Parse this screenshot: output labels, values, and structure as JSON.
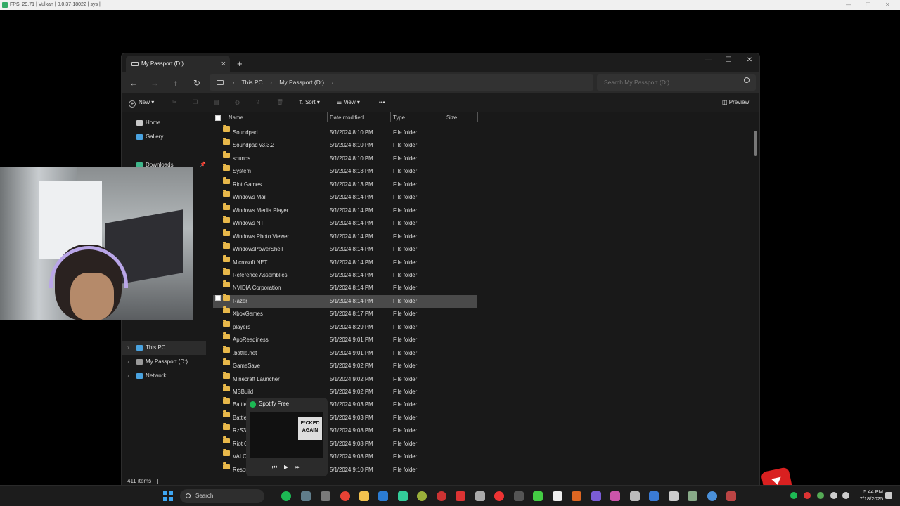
{
  "overlay": {
    "text": "FPS: 29.71 | Vulkan | 0.0.37-18022 | sys ||"
  },
  "window": {
    "tab_title": "My Passport (D:)",
    "new_tab": "+",
    "minimize": "—",
    "maximize": "☐",
    "close": "✕"
  },
  "address": {
    "back": "←",
    "forward": "→",
    "up": "↑",
    "refresh": "↻",
    "crumbs": [
      "This PC",
      "My Passport (D:)"
    ],
    "separator": "›",
    "search_placeholder": "Search My Passport (D:)"
  },
  "toolbar": {
    "new_label": "New",
    "sort_label": "Sort",
    "view_label": "View",
    "more_label": "•••",
    "preview_label": "Preview"
  },
  "nav": {
    "home": "Home",
    "gallery": "Gallery",
    "downloads": "Downloads",
    "this_pc": "This PC",
    "passport": "My Passport (D:)",
    "network": "Network"
  },
  "columns": {
    "name": "Name",
    "date": "Date modified",
    "type": "Type",
    "size": "Size"
  },
  "files": [
    {
      "name": "Soundpad",
      "date": "5/1/2024 8:10 PM",
      "type": "File folder"
    },
    {
      "name": "Soundpad v3.3.2",
      "date": "5/1/2024 8:10 PM",
      "type": "File folder"
    },
    {
      "name": "sounds",
      "date": "5/1/2024 8:10 PM",
      "type": "File folder"
    },
    {
      "name": "System",
      "date": "5/1/2024 8:13 PM",
      "type": "File folder"
    },
    {
      "name": "Riot Games",
      "date": "5/1/2024 8:13 PM",
      "type": "File folder"
    },
    {
      "name": "Windows Mail",
      "date": "5/1/2024 8:14 PM",
      "type": "File folder"
    },
    {
      "name": "Windows Media Player",
      "date": "5/1/2024 8:14 PM",
      "type": "File folder"
    },
    {
      "name": "Windows NT",
      "date": "5/1/2024 8:14 PM",
      "type": "File folder"
    },
    {
      "name": "Windows Photo Viewer",
      "date": "5/1/2024 8:14 PM",
      "type": "File folder"
    },
    {
      "name": "WindowsPowerShell",
      "date": "5/1/2024 8:14 PM",
      "type": "File folder"
    },
    {
      "name": "Microsoft.NET",
      "date": "5/1/2024 8:14 PM",
      "type": "File folder"
    },
    {
      "name": "Reference Assemblies",
      "date": "5/1/2024 8:14 PM",
      "type": "File folder"
    },
    {
      "name": "NVIDIA Corporation",
      "date": "5/1/2024 8:14 PM",
      "type": "File folder"
    },
    {
      "name": "Razer",
      "date": "5/1/2024 8:14 PM",
      "type": "File folder",
      "selected": true
    },
    {
      "name": "XboxGames",
      "date": "5/1/2024 8:17 PM",
      "type": "File folder"
    },
    {
      "name": "players",
      "date": "5/1/2024 8:29 PM",
      "type": "File folder"
    },
    {
      "name": "AppReadiness",
      "date": "5/1/2024 9:01 PM",
      "type": "File folder"
    },
    {
      "name": ".battle.net",
      "date": "5/1/2024 9:01 PM",
      "type": "File folder"
    },
    {
      "name": "GameSave",
      "date": "5/1/2024 9:02 PM",
      "type": "File folder"
    },
    {
      "name": "Minecraft Launcher",
      "date": "5/1/2024 9:02 PM",
      "type": "File folder"
    },
    {
      "name": "MSBuild",
      "date": "5/1/2024 9:02 PM",
      "type": "File folder"
    },
    {
      "name": "Battle.",
      "date": "5/1/2024 9:03 PM",
      "type": "File folder"
    },
    {
      "name": "Battle.",
      "date": "5/1/2024 9:03 PM",
      "type": "File folder"
    },
    {
      "name": "RzS3V",
      "date": "5/1/2024 9:08 PM",
      "type": "File folder"
    },
    {
      "name": "Riot C",
      "date": "5/1/2024 9:08 PM",
      "type": "File folder"
    },
    {
      "name": "VALOF",
      "date": "5/1/2024 9:08 PM",
      "type": "File folder"
    },
    {
      "name": "Resou",
      "date": "5/1/2024 9:10 PM",
      "type": "File folder"
    }
  ],
  "status": {
    "items": "411 items",
    "sep": "|"
  },
  "spotify": {
    "title": "Spotify Free",
    "art_text": "F*CKED AGAIN",
    "prev": "⏮",
    "play": "▶",
    "next": "⏭"
  },
  "taskbar": {
    "search": "Search",
    "time": "5:44 PM",
    "date": "7/18/2025"
  }
}
